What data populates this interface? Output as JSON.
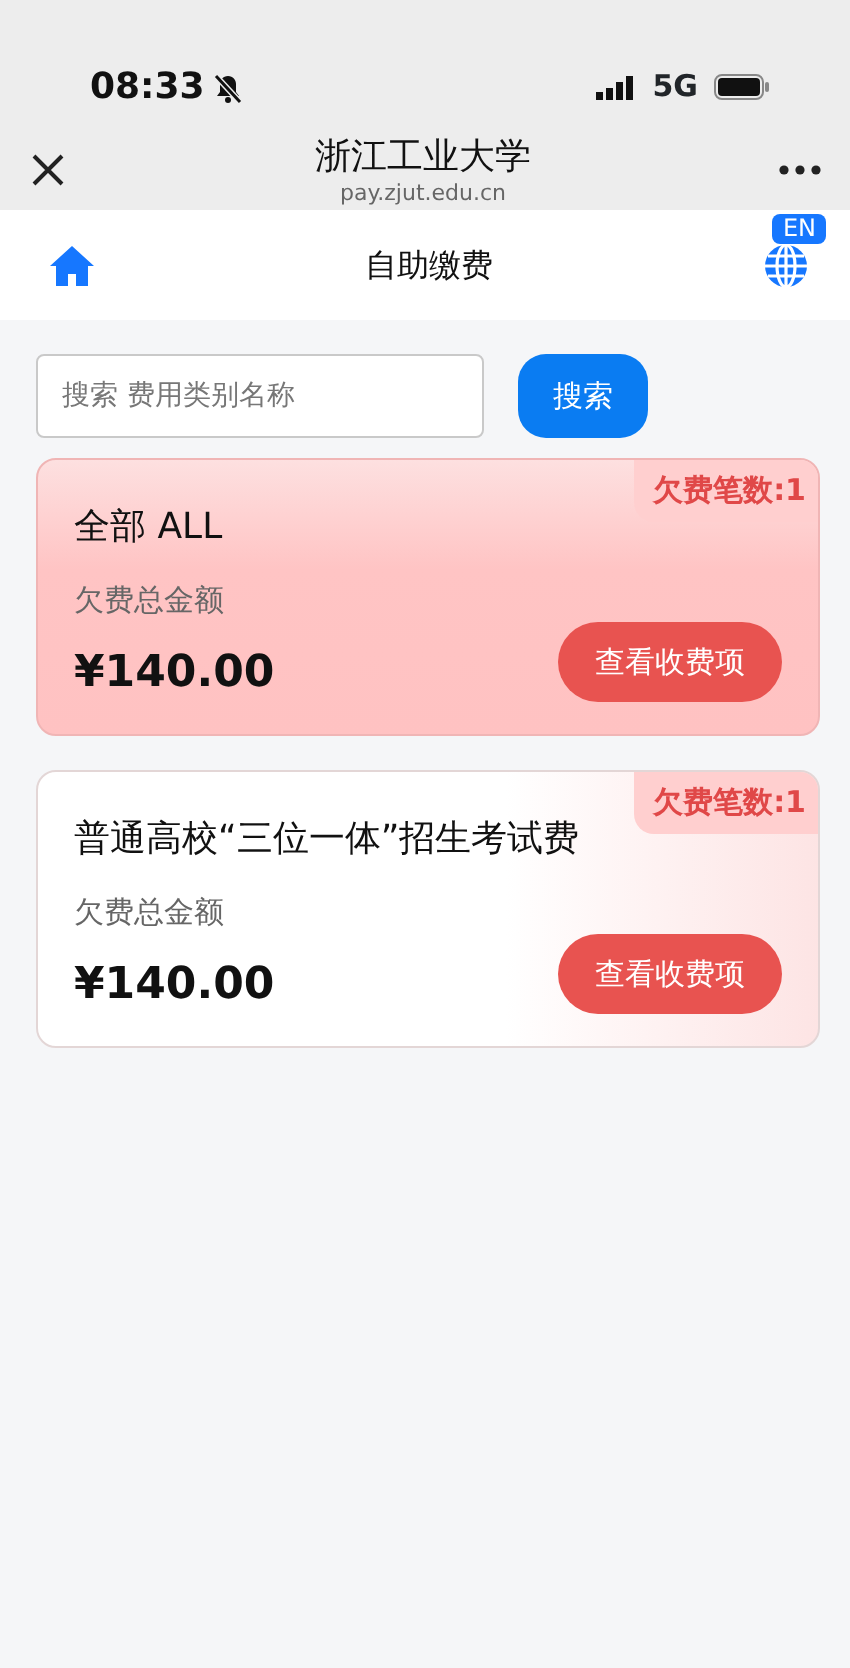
{
  "status_bar": {
    "time": "08:33",
    "network": "5G",
    "silent": true
  },
  "browser_bar": {
    "title": "浙江工业大学",
    "url": "pay.zjut.edu.cn"
  },
  "header": {
    "title": "自助缴费",
    "language_badge": "EN"
  },
  "search": {
    "placeholder": "搜索 费用类别名称",
    "button": "搜索"
  },
  "cards": [
    {
      "kind": "all",
      "count_badge": "欠费笔数:1",
      "title": "全部 ALL",
      "amount_label": "欠费总金额",
      "amount": "¥140.00",
      "button": "查看收费项"
    },
    {
      "kind": "category",
      "count_badge": "欠费笔数:1",
      "title": "普通高校“三位一体”招生考试费",
      "amount_label": "欠费总金额",
      "amount": "¥140.00",
      "button": "查看收费项"
    }
  ]
}
